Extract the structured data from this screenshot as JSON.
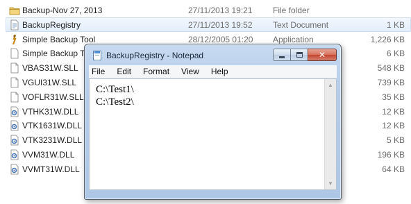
{
  "explorer": {
    "files": [
      {
        "name": "Backup-Nov 27, 2013",
        "date": "27/11/2013 19:21",
        "type": "File folder",
        "size": "",
        "icon": "folder-icon",
        "selected": false
      },
      {
        "name": "BackupRegistry",
        "date": "27/11/2013 19:52",
        "type": "Text Document",
        "size": "1 KB",
        "icon": "text-document-icon",
        "selected": true
      },
      {
        "name": "Simple Backup Tool",
        "date": "28/12/2005 01:20",
        "type": "Application",
        "size": "1,226 KB",
        "icon": "application-icon",
        "selected": false
      },
      {
        "name": "Simple Backup To",
        "date": "",
        "type": "",
        "size": "6 KB",
        "icon": "document-icon",
        "selected": false
      },
      {
        "name": "VBAS31W.SLL",
        "date": "",
        "type": "",
        "size": "548 KB",
        "icon": "file-icon",
        "selected": false
      },
      {
        "name": "VGUI31W.SLL",
        "date": "",
        "type": "",
        "size": "739 KB",
        "icon": "file-icon",
        "selected": false
      },
      {
        "name": "VOFLR31W.SLL",
        "date": "",
        "type": "",
        "size": "35 KB",
        "icon": "file-icon",
        "selected": false
      },
      {
        "name": "VTHK31W.DLL",
        "date": "",
        "type": "",
        "size": "12 KB",
        "icon": "dll-icon",
        "selected": false
      },
      {
        "name": "VTK1631W.DLL",
        "date": "",
        "type": "",
        "size": "12 KB",
        "icon": "dll-icon",
        "selected": false
      },
      {
        "name": "VTK3231W.DLL",
        "date": "",
        "type": "",
        "size": "5 KB",
        "icon": "dll-icon",
        "selected": false
      },
      {
        "name": "VVM31W.DLL",
        "date": "",
        "type": "",
        "size": "196 KB",
        "icon": "dll-icon",
        "selected": false
      },
      {
        "name": "VVMT31W.DLL",
        "date": "",
        "type": "",
        "size": "64 KB",
        "icon": "dll-icon",
        "selected": false
      }
    ]
  },
  "notepad": {
    "title": "BackupRegistry - Notepad",
    "menu": [
      "File",
      "Edit",
      "Format",
      "View",
      "Help"
    ],
    "lines": [
      "C:\\Test1\\",
      "C:\\Test2\\"
    ],
    "close_glyph": "✕",
    "icons": {
      "window": "notepad-icon",
      "minimize": "minimize-icon",
      "maximize": "maximize-icon",
      "close": "close-icon"
    }
  },
  "colors": {
    "selection": "#e3eefb",
    "folder": "#e8c15a",
    "dll_gear": "#4a78b8",
    "window_frame": "#b5cde9",
    "close_button": "#c4452f"
  }
}
